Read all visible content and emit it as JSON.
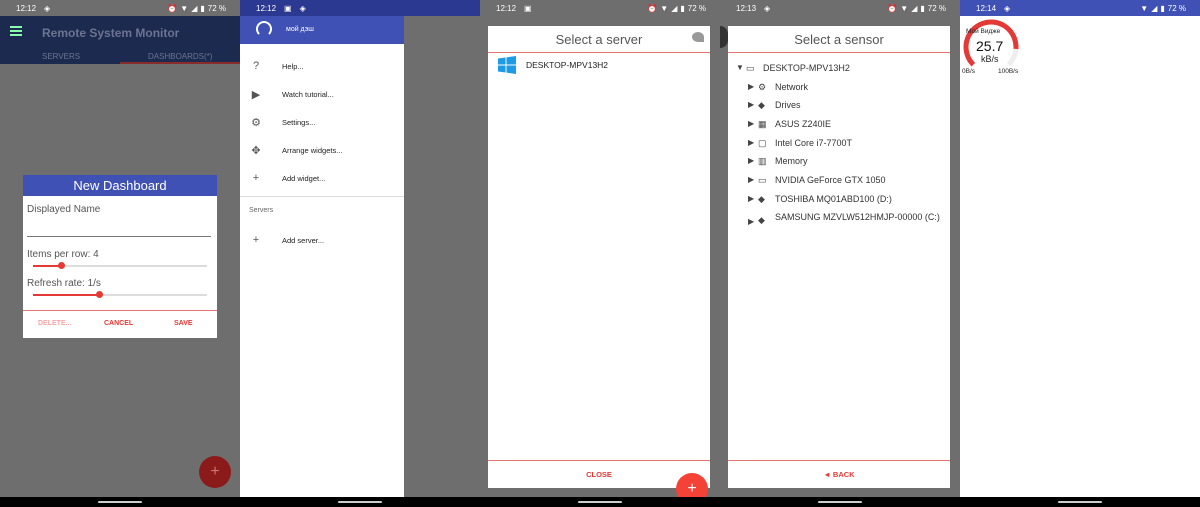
{
  "status": {
    "p1_time": "12:12",
    "p2_time": "12:12",
    "p3_time": "12:12",
    "p4_time": "12:13",
    "p5_time": "12:14",
    "battery": "72 %"
  },
  "p1": {
    "app_title": "Remote System Monitor",
    "tab_servers": "SERVERS",
    "tab_dashboards": "DASHBOARDS(*)",
    "dialog": {
      "title": "New Dashboard",
      "name_label": "Displayed Name",
      "name_value": "",
      "items_label": "Items per row: 4",
      "items_level": 0.16,
      "refresh_label": "Refresh rate: 1/s",
      "refresh_level": 0.38,
      "delete": "DELETE...",
      "cancel": "CANCEL",
      "save": "SAVE"
    },
    "fab": "+"
  },
  "p2": {
    "account": "мой дэш",
    "help_symbol": "?",
    "menu": [
      {
        "icon": "help-icon",
        "glyph": "?",
        "label": "Help..."
      },
      {
        "icon": "youtube-icon",
        "glyph": "▶",
        "label": "Watch tutorial..."
      },
      {
        "icon": "settings-icon",
        "glyph": "⚙",
        "label": "Settings..."
      },
      {
        "icon": "arrange-icon",
        "glyph": "✥",
        "label": "Arrange widgets..."
      },
      {
        "icon": "add-icon",
        "glyph": "+",
        "label": "Add widget..."
      }
    ],
    "section": "Servers",
    "add_server": {
      "icon": "add-icon",
      "glyph": "+",
      "label": "Add server..."
    }
  },
  "p3": {
    "title": "Select a server",
    "server": "DESKTOP-MPV13H2",
    "close": "CLOSE",
    "fab": "+"
  },
  "p4": {
    "title": "Select a sensor",
    "root": "DESKTOP-MPV13H2",
    "children": [
      {
        "icon": "network-icon",
        "glyph": "⚙",
        "label": "Network"
      },
      {
        "icon": "drive-icon",
        "glyph": "◆",
        "label": "Drives"
      },
      {
        "icon": "motherboard-icon",
        "glyph": "▦",
        "label": "ASUS Z240IE"
      },
      {
        "icon": "cpu-icon",
        "glyph": "▢",
        "label": "Intel Core i7-7700T"
      },
      {
        "icon": "memory-icon",
        "glyph": "▥",
        "label": "Memory"
      },
      {
        "icon": "gpu-icon",
        "glyph": "▭",
        "label": "NVIDIA GeForce GTX 1050"
      },
      {
        "icon": "drive-icon",
        "glyph": "◆",
        "label": "TOSHIBA MQ01ABD100 (D:)"
      },
      {
        "icon": "drive-icon",
        "glyph": "◆",
        "label": "SAMSUNG MZVLW512HMJP-00000 (C:)"
      }
    ],
    "back": "◄ BACK"
  },
  "p5": {
    "widget_name": "Мой Видже",
    "value": "25.7",
    "unit": "kB/s",
    "min": "0B/s",
    "max": "100B/s",
    "gauge_color": "#e53935",
    "gauge_level": 0.85
  }
}
